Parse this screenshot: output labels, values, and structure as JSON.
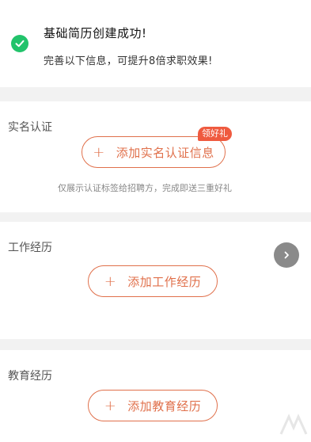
{
  "success": {
    "title": "基础简历创建成功!",
    "subtitle": "完善以下信息，可提升8倍求职效果!",
    "icon": "check-circle-icon"
  },
  "realname": {
    "label": "实名认证",
    "button_label": "添加实名认证信息",
    "badge": "领好礼",
    "hint": "仅展示认证标签给招聘方，完成即送三重好礼"
  },
  "work": {
    "label": "工作经历",
    "button_label": "添加工作经历",
    "nav_icon": "chevron-right-icon"
  },
  "education": {
    "label": "教育经历",
    "button_label": "添加教育经历"
  },
  "colors": {
    "accent": "#e0704b",
    "success": "#22c36b",
    "badge": "#ef5a3f"
  }
}
